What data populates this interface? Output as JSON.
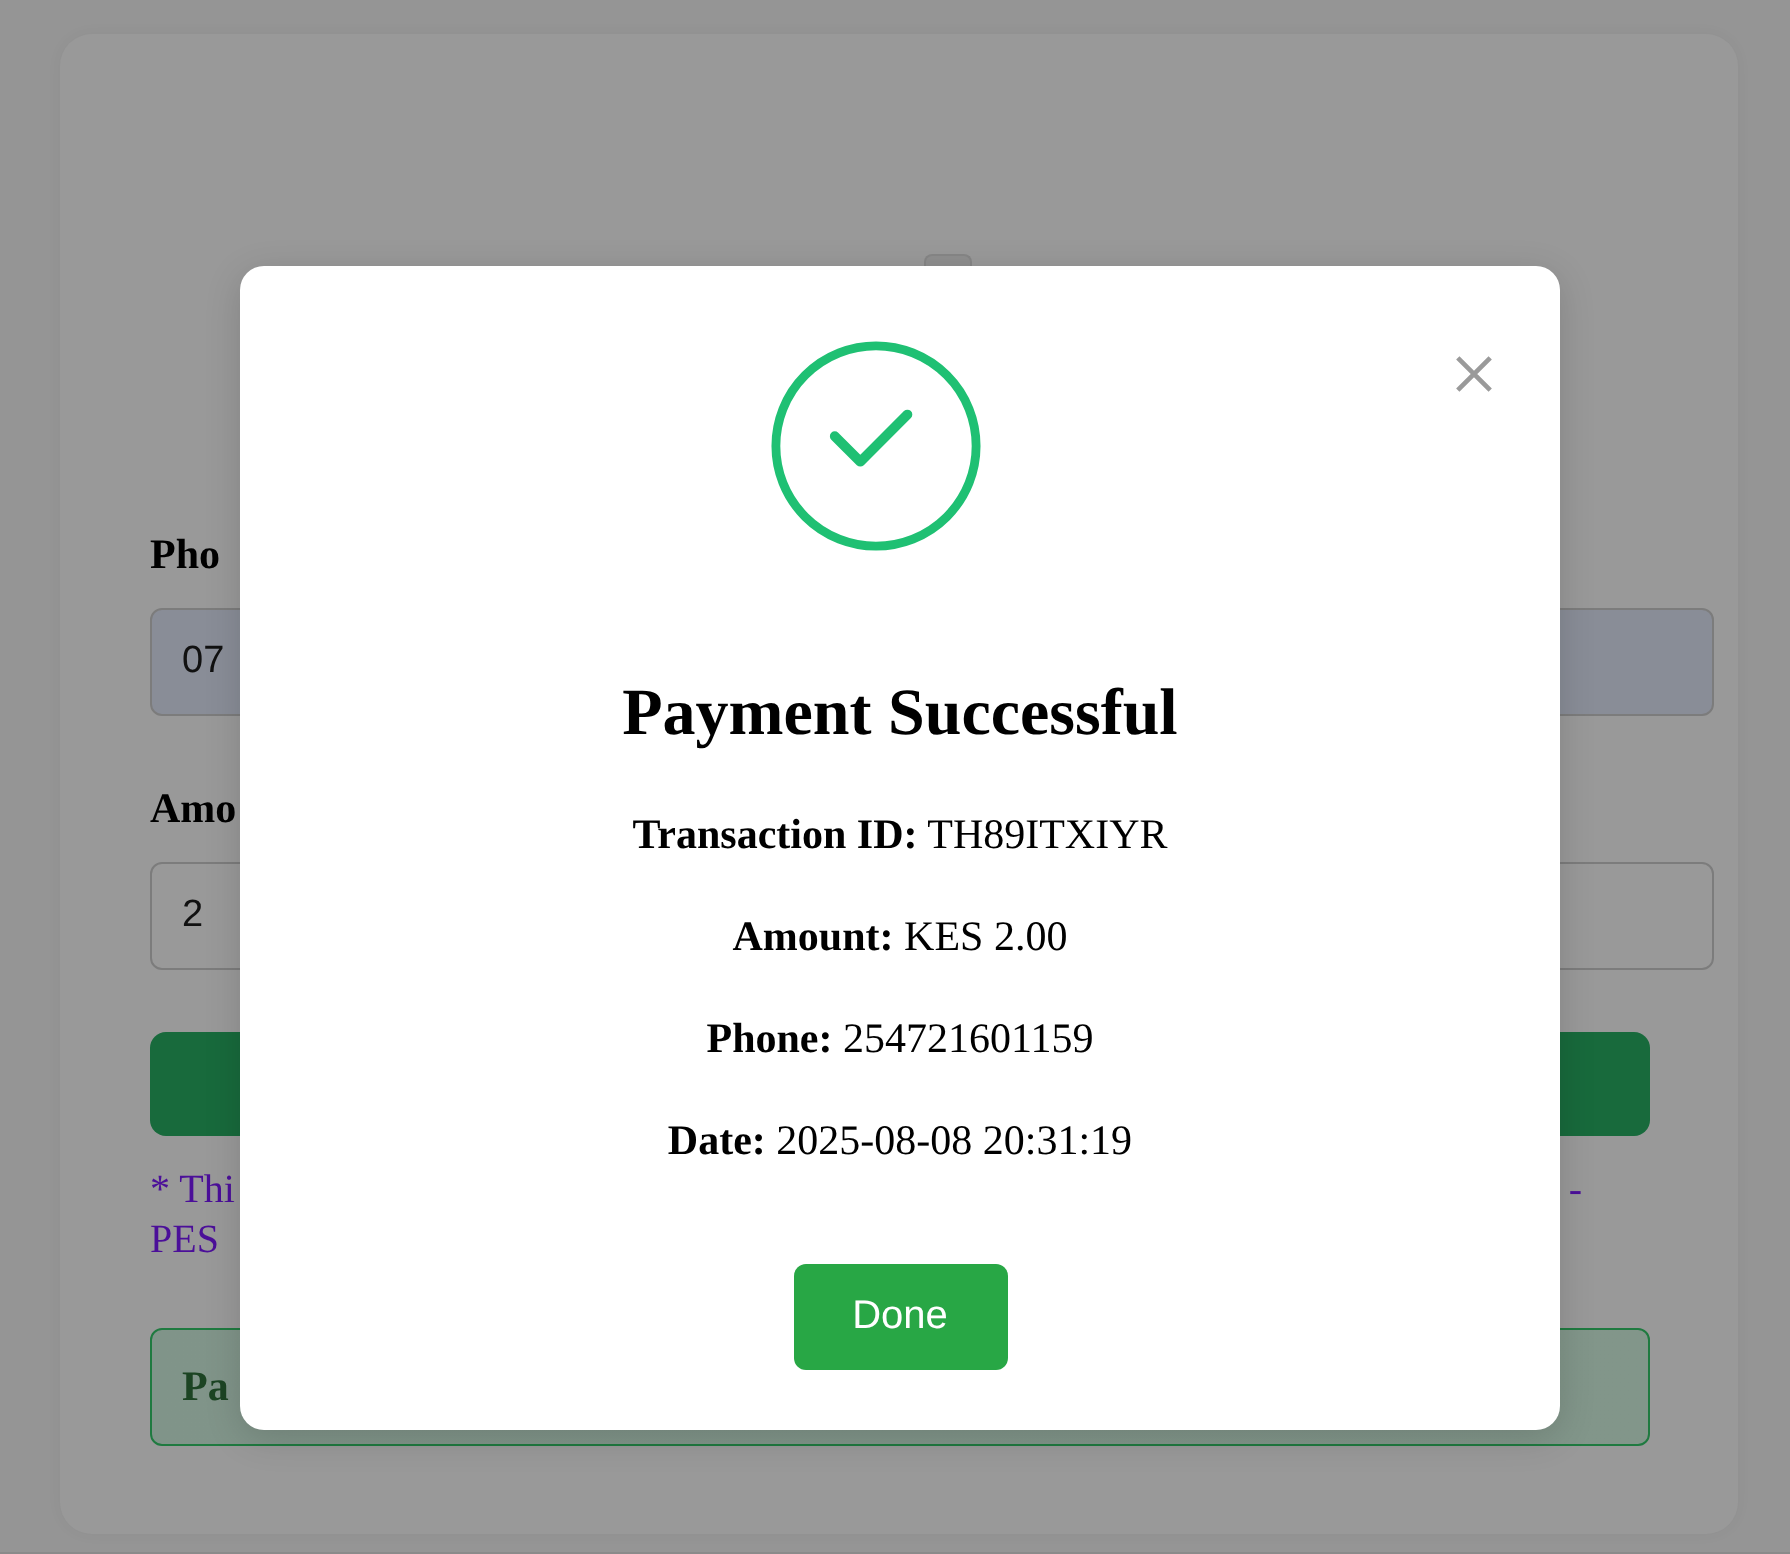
{
  "form": {
    "phone_label": "Pho",
    "phone_value": "07",
    "amount_label": "Amo",
    "amount_value": "2",
    "note": {
      "line_1_start": "* Thi",
      "line_1_end": "-",
      "line_2_start": "PES"
    },
    "status": "Pa"
  },
  "dialog": {
    "title": "Payment Successful",
    "details": [
      "**Transaction ID:** TH89ITXIYR",
      "**Amount:** KES 2.00",
      "**Phone:** 254721601159",
      "**Date:** 2025-08-08 20:31:19"
    ],
    "button": "Done"
  }
}
